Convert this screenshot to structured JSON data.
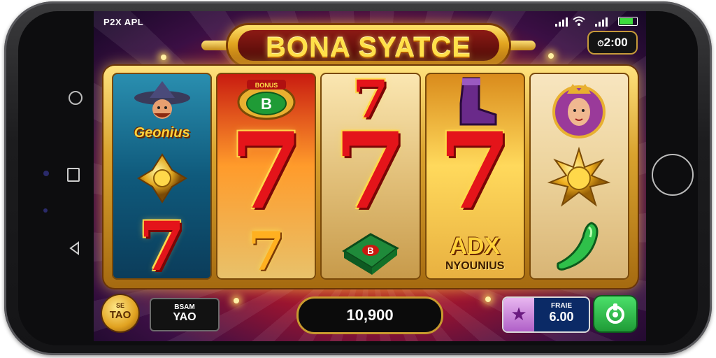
{
  "status_bar": {
    "carrier": "P2X APL",
    "battery_color": "#3ddc3d"
  },
  "game": {
    "title": "BONA SYATCE",
    "balance": "2:00",
    "reels": [
      {
        "symbols": [
          {
            "name": "wizard",
            "label": "Geonius"
          },
          {
            "name": "gold-gem"
          },
          {
            "name": "seven",
            "text": "7"
          }
        ]
      },
      {
        "symbols": [
          {
            "name": "bonus-badge",
            "badge_top": "BONUS",
            "badge_letter": "B"
          },
          {
            "name": "seven",
            "text": "7"
          },
          {
            "name": "seven",
            "text": "7"
          }
        ]
      },
      {
        "symbols": [
          {
            "name": "seven",
            "text": "7"
          },
          {
            "name": "seven",
            "text": "7"
          },
          {
            "name": "green-chip",
            "text": "B"
          }
        ]
      },
      {
        "symbols": [
          {
            "name": "boot"
          },
          {
            "name": "seven",
            "text": "7"
          },
          {
            "name": "ady-text",
            "label_top": "ADX",
            "label_bottom": "NYOUNIUS"
          }
        ]
      },
      {
        "symbols": [
          {
            "name": "queen"
          },
          {
            "name": "gold-sun"
          },
          {
            "name": "green-pepper"
          }
        ]
      }
    ]
  },
  "hud": {
    "coin_small": "SE",
    "coin_big": "TAO",
    "bet_small": "BSAM",
    "bet_big": "YAO",
    "win_value": "10,900",
    "bonus_small": "FRAIE",
    "bonus_big": "6.00",
    "bonus_star": "★"
  },
  "colors": {
    "accent_gold": "#e3a520",
    "spin_green": "#2fc04a",
    "seven_red": "#e4141a"
  }
}
